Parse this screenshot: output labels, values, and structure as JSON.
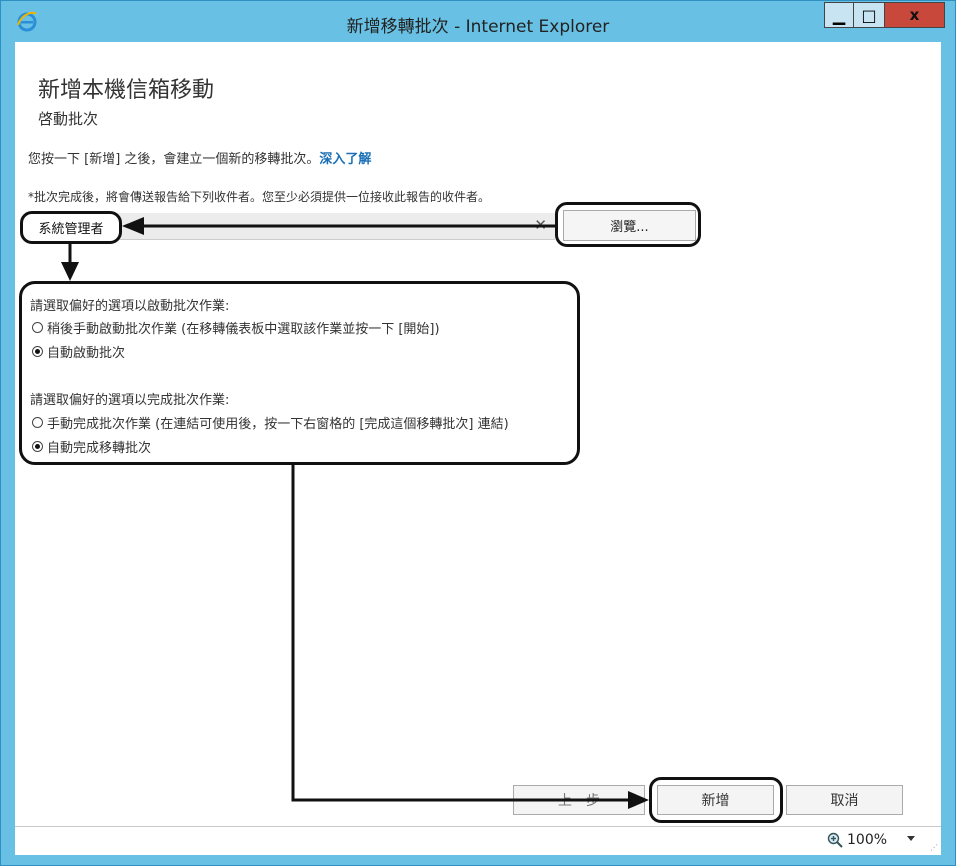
{
  "window": {
    "title": "新增移轉批次 - Internet Explorer",
    "controls": {
      "minimize": "▁",
      "maximize": "□",
      "close": "x"
    }
  },
  "page": {
    "heading": "新增本機信箱移動",
    "subheading": "啓動批次",
    "info_text": "您按一下 [新增] 之後，會建立一個新的移轉批次。",
    "learn_more": "深入了解",
    "report_note": "*批次完成後，將會傳送報告給下列收件者。您至少必須提供一位接收此報告的收件者。",
    "recipient": "系統管理者",
    "clear_glyph": "✕",
    "browse_label": "瀏覽...",
    "start_prompt": "請選取偏好的選項以啟動批次作業:",
    "start_options": [
      "稍後手動啟動批次作業 (在移轉儀表板中選取該作業並按一下 [開始])",
      "自動啟動批次"
    ],
    "start_selected": 1,
    "complete_prompt": "請選取偏好的選項以完成批次作業:",
    "complete_options": [
      "手動完成批次作業 (在連結可使用後，按一下右窗格的 [完成這個移轉批次] 連結)",
      "自動完成移轉批次"
    ],
    "complete_selected": 1
  },
  "buttons": {
    "back": "上一步",
    "new": "新增",
    "cancel": "取消"
  },
  "status": {
    "zoom": "100%"
  },
  "colors": {
    "frame": "#68c1e4",
    "close": "#c9483c",
    "link": "#1a6fb5"
  }
}
